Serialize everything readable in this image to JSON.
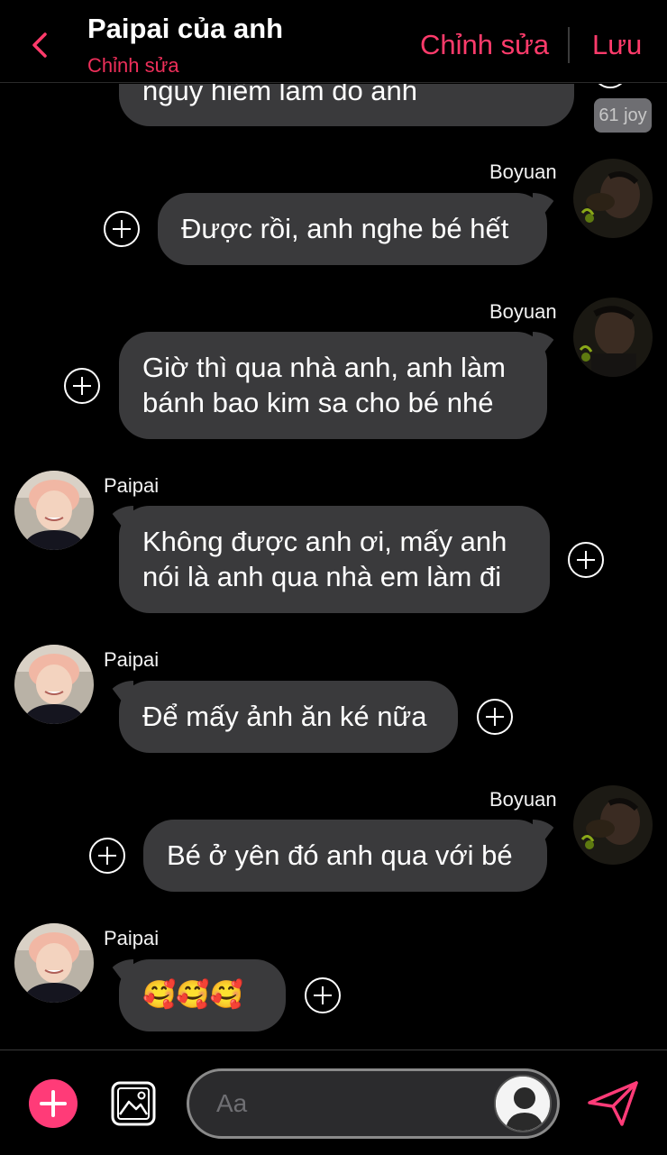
{
  "header": {
    "title": "Paipai của anh",
    "subtitle": "Chỉnh sửa",
    "edit_label": "Chỉnh sửa",
    "save_label": "Lưu",
    "accent_color": "#ff3b6b"
  },
  "chat": {
    "partial_top_message": "nguy hiểm lắm đó anh",
    "joy_badge": "61 joy",
    "messages": [
      {
        "sender": "Boyuan",
        "side": "right",
        "lines": [
          "Được rồi, anh nghe bé hết"
        ]
      },
      {
        "sender": "Boyuan",
        "side": "right",
        "lines": [
          "Giờ thì qua nhà anh, anh làm",
          "bánh bao kim sa cho bé nhé"
        ]
      },
      {
        "sender": "Paipai",
        "side": "left",
        "lines": [
          "Không được anh ơi, mấy anh",
          "nói là anh qua nhà em làm đi"
        ]
      },
      {
        "sender": "Paipai",
        "side": "left",
        "lines": [
          "Để mấy ảnh ăn ké nữa"
        ]
      },
      {
        "sender": "Boyuan",
        "side": "right",
        "lines": [
          "Bé ở yên đó anh qua với bé"
        ]
      },
      {
        "sender": "Paipai",
        "side": "left",
        "lines": [
          "🥰🥰🥰"
        ]
      }
    ]
  },
  "composer": {
    "placeholder": "Aa",
    "add_icon": "plus-icon",
    "image_icon": "image-icon",
    "send_icon": "send-icon",
    "add_color": "#ff3b78"
  }
}
